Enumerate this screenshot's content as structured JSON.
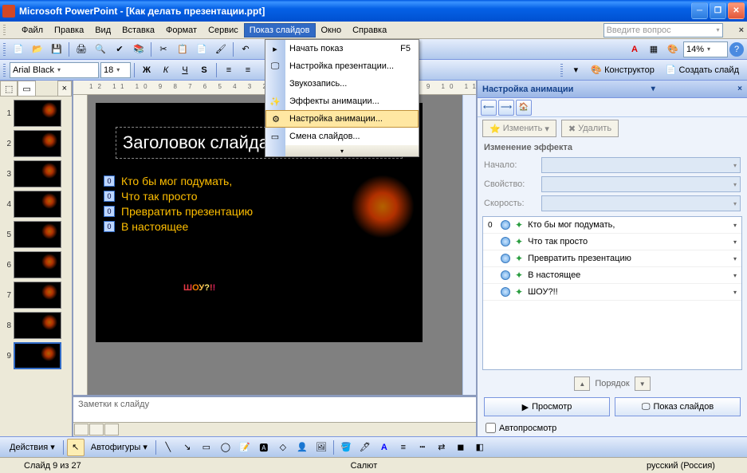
{
  "window": {
    "title": "Microsoft PowerPoint - [Как делать презентации.ppt]"
  },
  "menubar": {
    "items": [
      "Файл",
      "Правка",
      "Вид",
      "Вставка",
      "Формат",
      "Сервис",
      "Показ слайдов",
      "Окно",
      "Справка"
    ],
    "active_index": 6,
    "ask": "Введите вопрос"
  },
  "format_toolbar": {
    "font": "Arial Black",
    "size": "18",
    "zoom": "14%",
    "designer": "Конструктор",
    "new_slide": "Создать слайд"
  },
  "dropdown": {
    "items": [
      {
        "label": "Начать показ",
        "shortcut": "F5"
      },
      {
        "label": "Настройка презентации..."
      },
      {
        "label": "Звукозапись..."
      },
      {
        "label": "Эффекты анимации..."
      },
      {
        "label": "Настройка анимации...",
        "highlight": true
      },
      {
        "label": "Смена слайдов..."
      }
    ]
  },
  "slide": {
    "title": "Заголовок слайда",
    "bullets": [
      "Кто бы мог подумать,",
      "Что так просто",
      "Превратить презентацию",
      "В настоящее"
    ],
    "show": "ШОУ?!!"
  },
  "notes_placeholder": "Заметки к слайду",
  "task_pane": {
    "title": "Настройка анимации",
    "modify_btn": "Изменить",
    "delete_btn": "Удалить",
    "section": "Изменение эффекта",
    "props": {
      "start": "Начало:",
      "property": "Свойство:",
      "speed": "Скорость:"
    },
    "anims": [
      {
        "idx": "0",
        "text": "Кто бы мог подумать,"
      },
      {
        "idx": "",
        "text": "Что так просто"
      },
      {
        "idx": "",
        "text": "Превратить презентацию"
      },
      {
        "idx": "",
        "text": "В настоящее"
      },
      {
        "idx": "",
        "text": "ШОУ?!!"
      }
    ],
    "order": "Порядок",
    "preview": "Просмотр",
    "slideshow": "Показ слайдов",
    "autopreview": "Автопросмотр"
  },
  "draw_toolbar": {
    "actions": "Действия",
    "autoshapes": "Автофигуры"
  },
  "statusbar": {
    "slide": "Слайд 9 из 27",
    "design": "Салют",
    "lang": "русский (Россия)"
  }
}
